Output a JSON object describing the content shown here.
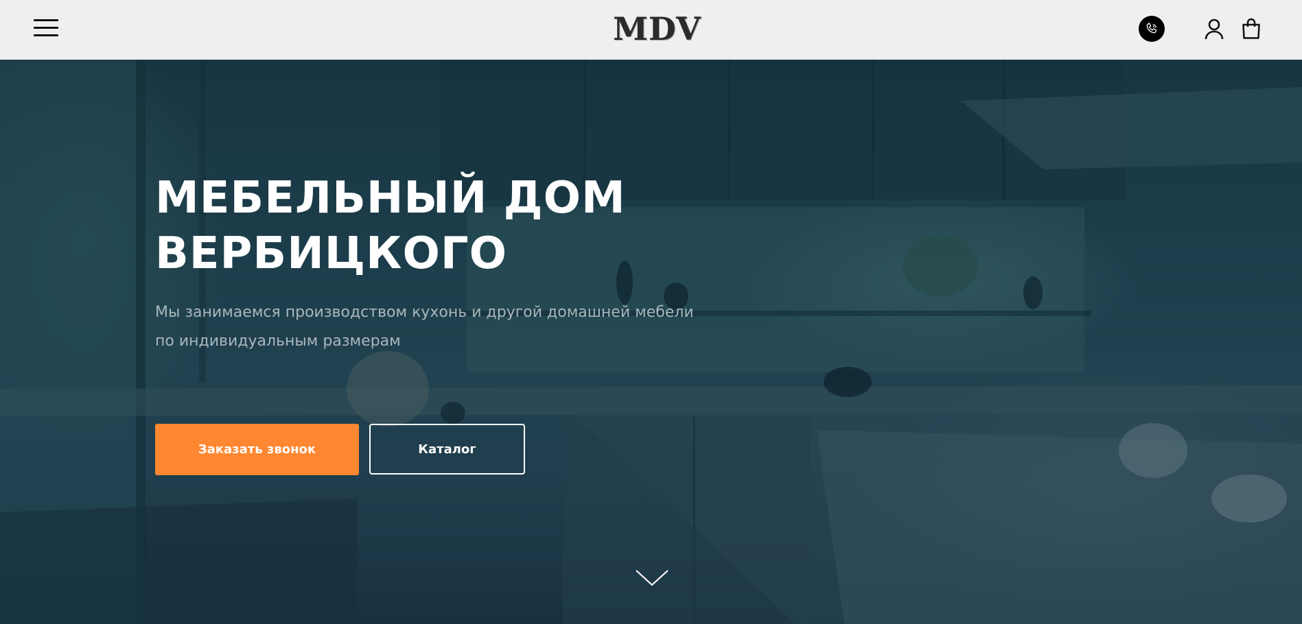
{
  "header": {
    "menu_icon": "hamburger-menu-icon",
    "logo_text": "MDV",
    "phone_icon": "phone-icon",
    "user_icon": "user-icon",
    "cart_icon": "shopping-bag-icon"
  },
  "hero": {
    "title_line1": "МЕБЕЛЬНЫЙ ДОМ",
    "title_line2": "ВЕРБИЦКОГО",
    "subtitle_line1": "Мы занимаемся производством кухонь и другой домашней мебели",
    "subtitle_line2": "по индивидуальным размерам",
    "call_button_label": "Заказать звонок",
    "catalog_button_label": "Каталог",
    "scroll_icon": "chevron-down-icon",
    "background_image": "kitchen-interior-photo"
  },
  "colors": {
    "accent": "#ff8732",
    "header_bg": "#efefef",
    "hero_overlay": "#1e3a47",
    "title_text": "#ffffff",
    "subtitle_text": "#a9b7bd"
  }
}
